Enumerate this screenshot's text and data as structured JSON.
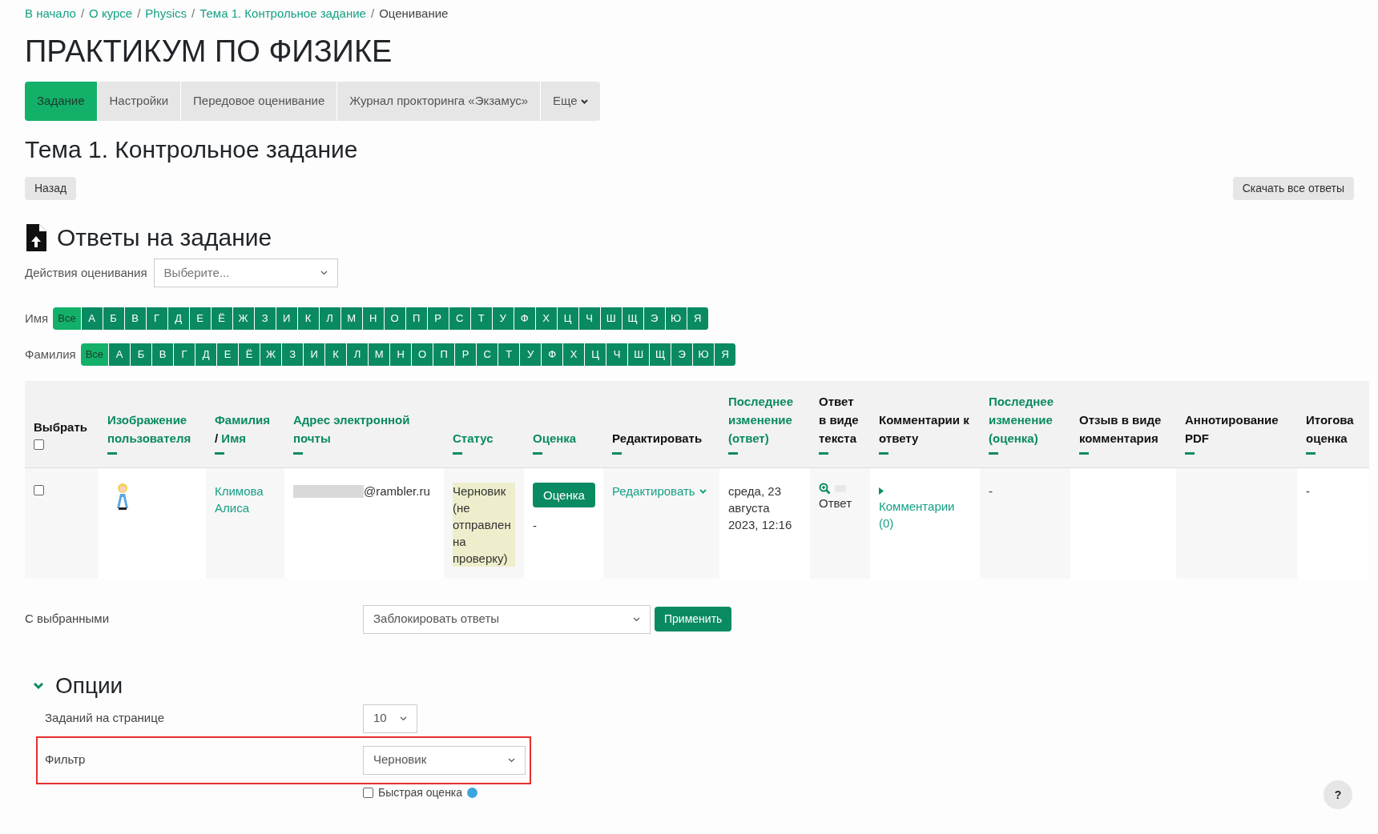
{
  "breadcrumb": [
    {
      "label": "В начало",
      "link": true
    },
    {
      "separator": "/",
      "label": "О курсе",
      "link": true
    },
    {
      "separator": "/",
      "label": "Physics",
      "link": true
    },
    {
      "separator": "/",
      "label": "Тема 1. Контрольное задание",
      "link": true
    },
    {
      "separator": "/",
      "label": "Оценивание",
      "link": false
    }
  ],
  "title": "ПРАКТИКУМ ПО ФИЗИКЕ",
  "tabs": [
    {
      "label": "Задание",
      "selected": true,
      "kind": "tab"
    },
    {
      "label": "Настройки",
      "selected": false,
      "kind": "tab"
    },
    {
      "label": "Передовое оценивание",
      "selected": false,
      "kind": "tab"
    },
    {
      "label": "Журнал прокторинга «Экзамус»",
      "selected": false,
      "kind": "tab"
    },
    {
      "label": "Еще",
      "selected": false,
      "kind": "dropdown"
    }
  ],
  "section_title": "Тема 1. Контрольное задание",
  "back_button": "Назад",
  "download_button": "Скачать все ответы",
  "submissions_title": "Ответы на задание",
  "grading_action": {
    "label": "Действия оценивания",
    "placeholder": "Выберите..."
  },
  "letter_filters": [
    {
      "label": "Имя",
      "letters": [
        {
          "label": "Все",
          "selected": true
        },
        {
          "label": "А",
          "selected": false
        },
        {
          "label": "Б",
          "selected": false
        },
        {
          "label": "В",
          "selected": false
        },
        {
          "label": "Г",
          "selected": false
        },
        {
          "label": "Д",
          "selected": false
        },
        {
          "label": "Е",
          "selected": false
        },
        {
          "label": "Ё",
          "selected": false
        },
        {
          "label": "Ж",
          "selected": false
        },
        {
          "label": "З",
          "selected": false
        },
        {
          "label": "И",
          "selected": false
        },
        {
          "label": "К",
          "selected": false
        },
        {
          "label": "Л",
          "selected": false
        },
        {
          "label": "М",
          "selected": false
        },
        {
          "label": "Н",
          "selected": false
        },
        {
          "label": "О",
          "selected": false
        },
        {
          "label": "П",
          "selected": false
        },
        {
          "label": "Р",
          "selected": false
        },
        {
          "label": "С",
          "selected": false
        },
        {
          "label": "Т",
          "selected": false
        },
        {
          "label": "У",
          "selected": false
        },
        {
          "label": "Ф",
          "selected": false
        },
        {
          "label": "Х",
          "selected": false
        },
        {
          "label": "Ц",
          "selected": false
        },
        {
          "label": "Ч",
          "selected": false
        },
        {
          "label": "Ш",
          "selected": false
        },
        {
          "label": "Щ",
          "selected": false
        },
        {
          "label": "Э",
          "selected": false
        },
        {
          "label": "Ю",
          "selected": false
        },
        {
          "label": "Я",
          "selected": false
        }
      ]
    },
    {
      "label": "Фамилия",
      "letters": [
        {
          "label": "Все",
          "selected": true
        },
        {
          "label": "А",
          "selected": false
        },
        {
          "label": "Б",
          "selected": false
        },
        {
          "label": "В",
          "selected": false
        },
        {
          "label": "Г",
          "selected": false
        },
        {
          "label": "Д",
          "selected": false
        },
        {
          "label": "Е",
          "selected": false
        },
        {
          "label": "Ё",
          "selected": false
        },
        {
          "label": "Ж",
          "selected": false
        },
        {
          "label": "З",
          "selected": false
        },
        {
          "label": "И",
          "selected": false
        },
        {
          "label": "К",
          "selected": false
        },
        {
          "label": "Л",
          "selected": false
        },
        {
          "label": "М",
          "selected": false
        },
        {
          "label": "Н",
          "selected": false
        },
        {
          "label": "О",
          "selected": false
        },
        {
          "label": "П",
          "selected": false
        },
        {
          "label": "Р",
          "selected": false
        },
        {
          "label": "С",
          "selected": false
        },
        {
          "label": "Т",
          "selected": false
        },
        {
          "label": "У",
          "selected": false
        },
        {
          "label": "Ф",
          "selected": false
        },
        {
          "label": "Х",
          "selected": false
        },
        {
          "label": "Ц",
          "selected": false
        },
        {
          "label": "Ч",
          "selected": false
        },
        {
          "label": "Ш",
          "selected": false
        },
        {
          "label": "Щ",
          "selected": false
        },
        {
          "label": "Э",
          "selected": false
        },
        {
          "label": "Ю",
          "selected": false
        },
        {
          "label": "Я",
          "selected": false
        }
      ]
    }
  ],
  "table": {
    "columns": [
      {
        "kind": "select",
        "label": "Выбрать",
        "checked": false
      },
      {
        "kind": "sortable",
        "label": "Изображение пользователя"
      },
      {
        "kind": "name",
        "parts": [
          "Фамилия",
          "/",
          "Имя"
        ]
      },
      {
        "kind": "sortable",
        "label": "Адрес электронной почты"
      },
      {
        "kind": "sortable",
        "label": "Статус"
      },
      {
        "kind": "sortable",
        "label": "Оценка"
      },
      {
        "kind": "plain",
        "label": "Редактировать"
      },
      {
        "kind": "sortable",
        "label": "Последнее изменение (ответ)"
      },
      {
        "kind": "plain",
        "label": "Ответ в виде текста"
      },
      {
        "kind": "plain",
        "label": "Комментарии к ответу"
      },
      {
        "kind": "sortable",
        "label": "Последнее изменение (оценка)"
      },
      {
        "kind": "plain",
        "label": "Отзыв в виде комментария"
      },
      {
        "kind": "plain",
        "label": "Аннотирование PDF"
      },
      {
        "kind": "plain",
        "label": "Итогова оценка"
      }
    ],
    "rows": [
      {
        "cells": [
          {
            "kind": "checkbox",
            "checked": false
          },
          {
            "kind": "avatar"
          },
          {
            "kind": "link",
            "text": "Климова Алиса"
          },
          {
            "kind": "email",
            "text": "@rambler.ru"
          },
          {
            "kind": "status",
            "text": "Черновик (не отправлен на проверку)"
          },
          {
            "kind": "grade",
            "button": "Оценка",
            "text": "-"
          },
          {
            "kind": "menu",
            "text": "Редактировать"
          },
          {
            "kind": "text",
            "text": "среда, 23 августа 2023, 12:16"
          },
          {
            "kind": "onlinetext",
            "text": "Ответ"
          },
          {
            "kind": "comments",
            "text": "Комментарии (0)"
          },
          {
            "kind": "text",
            "text": "-"
          },
          {
            "kind": "empty"
          },
          {
            "kind": "empty"
          },
          {
            "kind": "text",
            "text": "-"
          }
        ]
      }
    ]
  },
  "with_selected": {
    "label": "С выбранными",
    "value": "Заблокировать ответы",
    "button": "Применить"
  },
  "options": {
    "title": "Опции",
    "expanded": true,
    "per_page": {
      "label": "Заданий на странице",
      "value": "10"
    },
    "filter": {
      "label": "Фильтр",
      "value": "Черновик",
      "highlighted": true
    },
    "quick_grading": {
      "label": "Быстрая оценка",
      "checked": false
    }
  },
  "help_button": "?"
}
